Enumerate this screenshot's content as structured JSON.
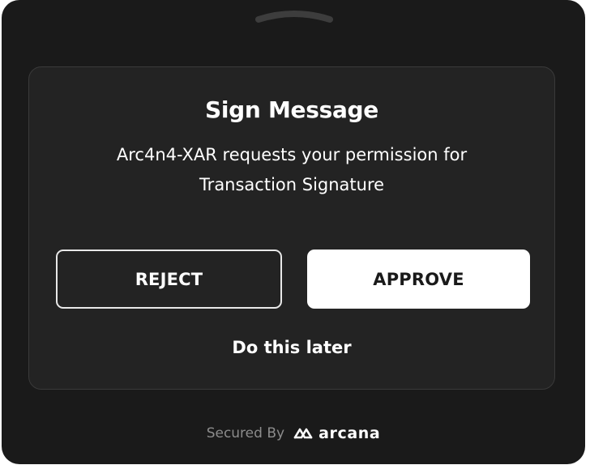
{
  "dialog": {
    "title": "Sign Message",
    "description_line1": "Arc4n4-XAR requests your permission for",
    "description_line2": "Transaction Signature",
    "reject_label": "REJECT",
    "approve_label": "APPROVE",
    "later_label": "Do this later"
  },
  "footer": {
    "secured_by": "Secured By",
    "brand_name": "arcana",
    "brand_icon": "arcana-logo-icon"
  },
  "colors": {
    "background": "#1a1a1a",
    "card": "#232323",
    "text": "#ffffff",
    "muted": "#8c8c8c"
  }
}
